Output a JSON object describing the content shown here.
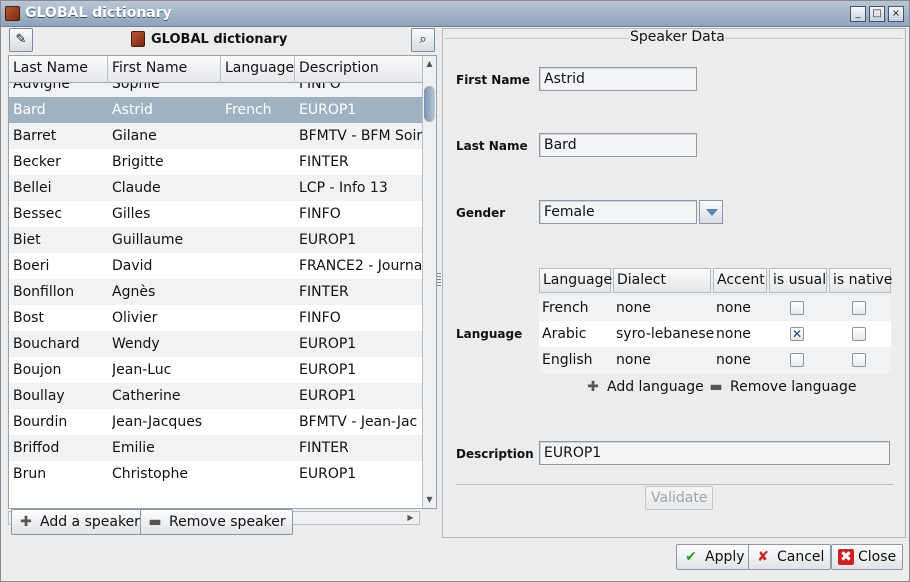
{
  "window": {
    "title": "GLOBAL dictionary"
  },
  "left": {
    "panel_title": "GLOBAL dictionary",
    "columns": [
      "Last Name",
      "First Name",
      "Language",
      "Description"
    ],
    "rows": [
      {
        "last": "Auvigne",
        "first": "Sophie",
        "language": "",
        "description": "FINFO"
      },
      {
        "last": "Bard",
        "first": "Astrid",
        "language": "French",
        "description": "EUROP1"
      },
      {
        "last": "Barret",
        "first": "Gilane",
        "language": "",
        "description": "BFMTV - BFM Soir"
      },
      {
        "last": "Becker",
        "first": "Brigitte",
        "language": "",
        "description": "FINTER"
      },
      {
        "last": "Bellei",
        "first": "Claude",
        "language": "",
        "description": "LCP - Info 13"
      },
      {
        "last": "Bessec",
        "first": "Gilles",
        "language": "",
        "description": "FINFO"
      },
      {
        "last": "Biet",
        "first": "Guillaume",
        "language": "",
        "description": "EUROP1"
      },
      {
        "last": "Boeri",
        "first": "David",
        "language": "",
        "description": "FRANCE2 - Journa"
      },
      {
        "last": "Bonfillon",
        "first": "Agnès",
        "language": "",
        "description": "FINTER"
      },
      {
        "last": "Bost",
        "first": "Olivier",
        "language": "",
        "description": "FINFO"
      },
      {
        "last": "Bouchard",
        "first": "Wendy",
        "language": "",
        "description": "EUROP1"
      },
      {
        "last": "Boujon",
        "first": "Jean-Luc",
        "language": "",
        "description": "EUROP1"
      },
      {
        "last": "Boullay",
        "first": "Catherine",
        "language": "",
        "description": "EUROP1"
      },
      {
        "last": "Bourdin",
        "first": "Jean-Jacques",
        "language": "",
        "description": "BFMTV - Jean-Jac"
      },
      {
        "last": "Briffod",
        "first": "Emilie",
        "language": "",
        "description": "FINTER"
      },
      {
        "last": "Brun",
        "first": "Christophe",
        "language": "",
        "description": "EUROP1"
      }
    ],
    "selected_index": 1,
    "add_speaker": "Add a speaker",
    "remove_speaker": "Remove speaker"
  },
  "speaker": {
    "group_title": "Speaker Data",
    "first_name_label": "First Name",
    "first_name": "Astrid",
    "last_name_label": "Last Name",
    "last_name": "Bard",
    "gender_label": "Gender",
    "gender": "Female",
    "language_label": "Language",
    "lang_columns": [
      "Language",
      "Dialect",
      "Accent",
      "is usual",
      "is native"
    ],
    "languages": [
      {
        "language": "French",
        "dialect": "none",
        "accent": "none",
        "is_usual": false,
        "is_native": false
      },
      {
        "language": "Arabic",
        "dialect": "syro-lebanese",
        "accent": "none",
        "is_usual": true,
        "is_native": false
      },
      {
        "language": "English",
        "dialect": "none",
        "accent": "none",
        "is_usual": false,
        "is_native": false
      }
    ],
    "add_language": "Add language",
    "remove_language": "Remove language",
    "description_label": "Description",
    "description": "EUROP1",
    "validate": "Validate"
  },
  "footer": {
    "apply": "Apply",
    "cancel": "Cancel",
    "close": "Close"
  },
  "colors": {
    "selection": "#9fb2c1",
    "titlebar": "#8ea3ba"
  }
}
